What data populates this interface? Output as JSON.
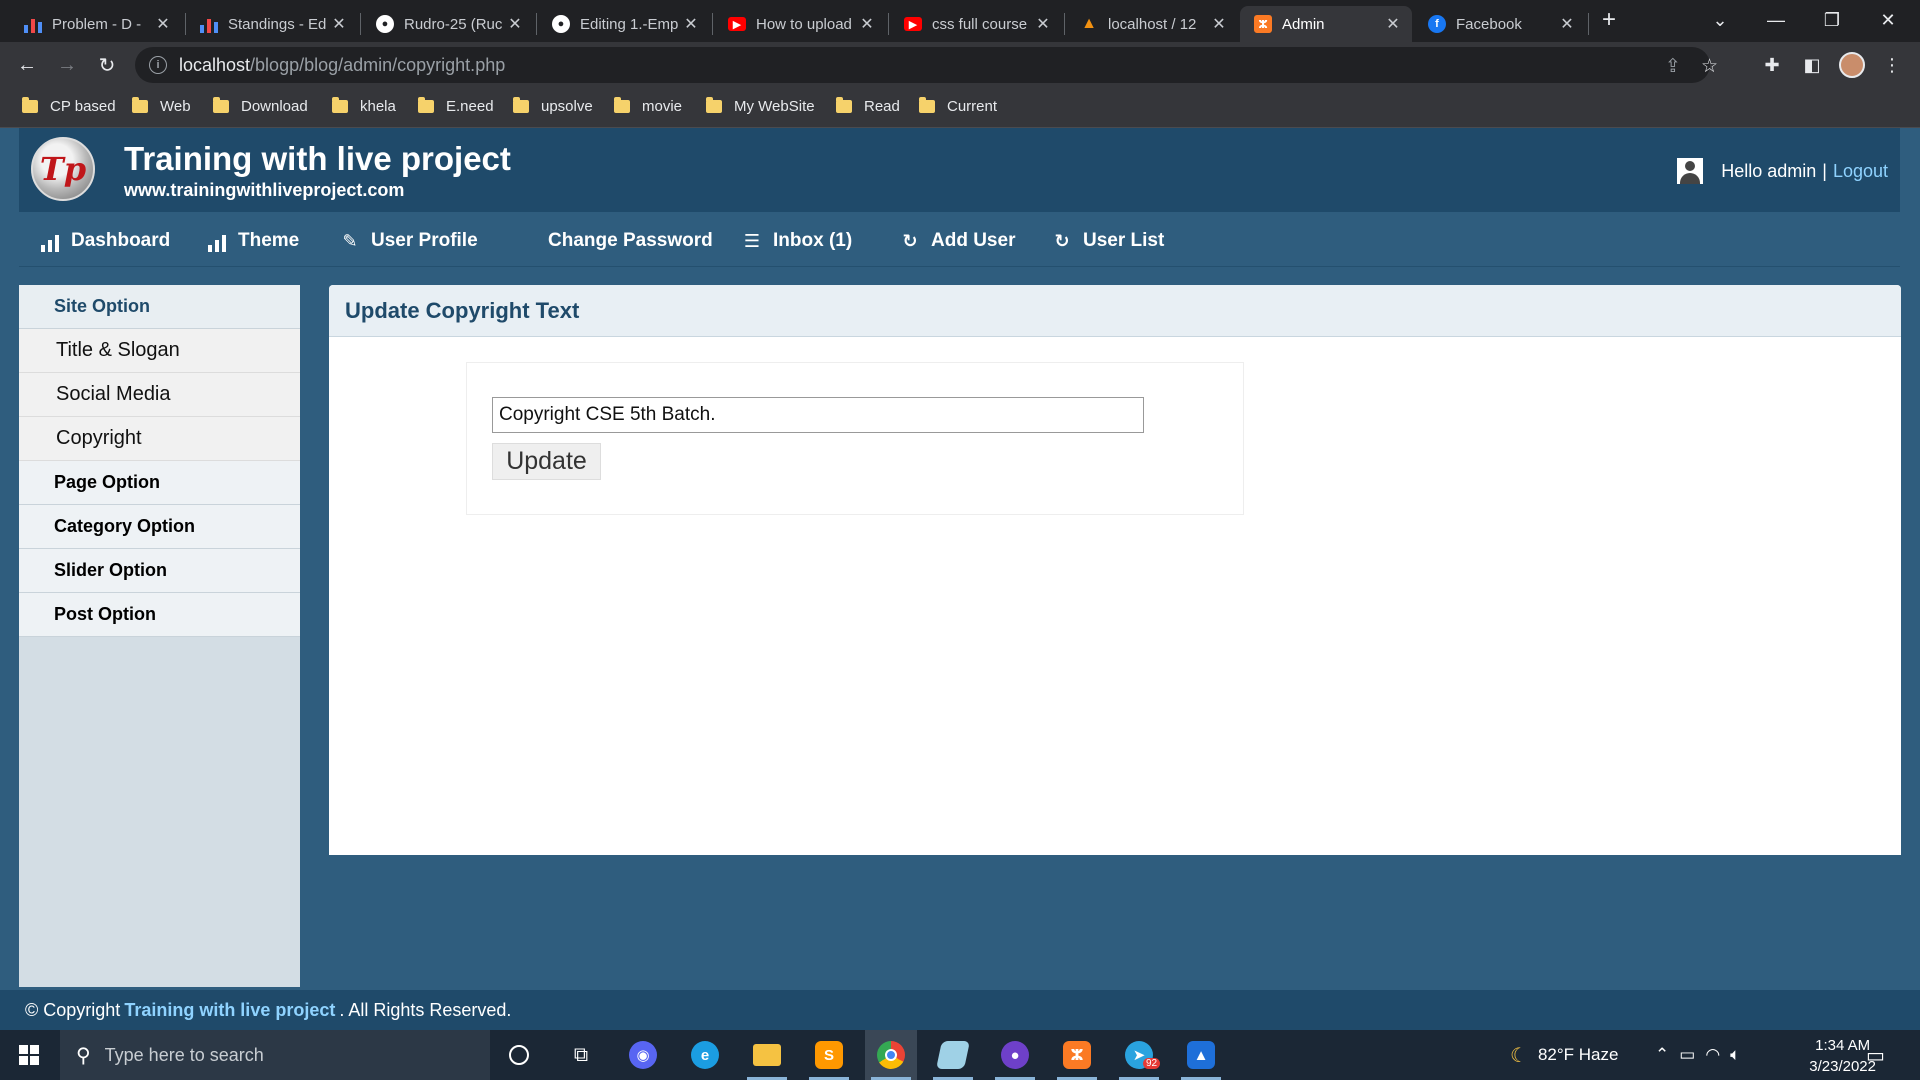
{
  "browser": {
    "tabs": [
      {
        "title": "Problem - D - ",
        "icon": "bar-chart-icon",
        "color": "#4f8ff7"
      },
      {
        "title": "Standings - Ed",
        "icon": "bar-chart-icon",
        "color": "#4f8ff7"
      },
      {
        "title": "Rudro-25 (Ruc",
        "icon": "github-icon",
        "color": "#ffffff"
      },
      {
        "title": "Editing 1.-Emp",
        "icon": "github-icon",
        "color": "#ffffff"
      },
      {
        "title": "How to upload",
        "icon": "youtube-icon",
        "color": "#ff0000"
      },
      {
        "title": "css full course",
        "icon": "youtube-icon",
        "color": "#ff0000"
      },
      {
        "title": "localhost / 12",
        "icon": "phpmyadmin-icon",
        "color": "#f29111"
      },
      {
        "title": "Admin",
        "icon": "xampp-icon",
        "color": "#fb7a24",
        "active": true
      },
      {
        "title": "Facebook",
        "icon": "facebook-icon",
        "color": "#1877f2"
      }
    ],
    "url_host": "localhost",
    "url_path": "/blogp/blog/admin/copyright.php",
    "bookmarks": [
      "CP based",
      "Web",
      "Download",
      "khela",
      "E.need",
      "upsolve",
      "movie",
      "My WebSite",
      "Read",
      "Current"
    ]
  },
  "header": {
    "logo_text": "Tp",
    "title": "Training with live project",
    "url": "www.trainingwithliveproject.com",
    "greeting": "Hello admin",
    "separator": "|",
    "logout": "Logout"
  },
  "nav": [
    {
      "label": "Dashboard",
      "icon": "bar-chart-icon"
    },
    {
      "label": "Theme",
      "icon": "bar-chart-icon"
    },
    {
      "label": "User Profile",
      "icon": "edit-icon"
    },
    {
      "label": "Change Password",
      "icon": ""
    },
    {
      "label": "Inbox (1)",
      "icon": "list-icon"
    },
    {
      "label": "Add User",
      "icon": "refresh-icon"
    },
    {
      "label": "User List",
      "icon": "refresh-icon"
    }
  ],
  "sidebar": {
    "site_option": "Site Option",
    "links": [
      "Title & Slogan",
      "Social Media",
      "Copyright"
    ],
    "page_option": "Page Option",
    "category_option": "Category Option",
    "slider_option": "Slider Option",
    "post_option": "Post Option"
  },
  "content": {
    "heading": "Update Copyright Text",
    "input_value": "Copyright CSE 5th Batch.",
    "button": "Update"
  },
  "footer": {
    "prefix": "© Copyright",
    "link": "Training with live project",
    "suffix": ". All Rights Reserved."
  },
  "taskbar": {
    "search_placeholder": "Type here to search",
    "weather": "82°F  Haze",
    "time": "1:34 AM",
    "date": "3/23/2022",
    "telegram_badge": "92"
  }
}
